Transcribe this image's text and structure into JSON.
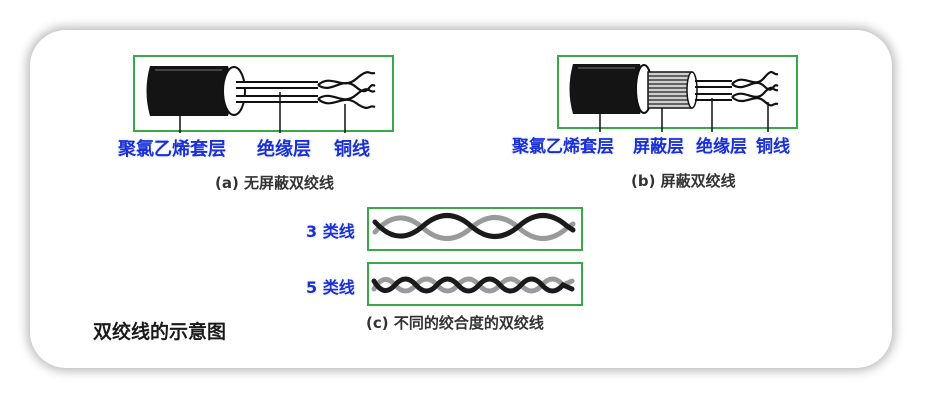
{
  "diagram_a": {
    "labels": [
      "聚氯乙烯套层",
      "绝缘层",
      "铜线"
    ],
    "caption": "(a) 无屏蔽双绞线"
  },
  "diagram_b": {
    "labels": [
      "聚氯乙烯套层",
      "屏蔽层",
      "绝缘层",
      "铜线"
    ],
    "caption": "(b) 屏蔽双绞线"
  },
  "diagram_c": {
    "rows": [
      {
        "label": "3 类线"
      },
      {
        "label": "5 类线"
      }
    ],
    "caption": "(c) 不同的绞合度的双绞线"
  },
  "title": "双绞线的示意图",
  "colors": {
    "frame": "#3aa84a",
    "label": "#1a2fd6",
    "caption": "#333333"
  }
}
